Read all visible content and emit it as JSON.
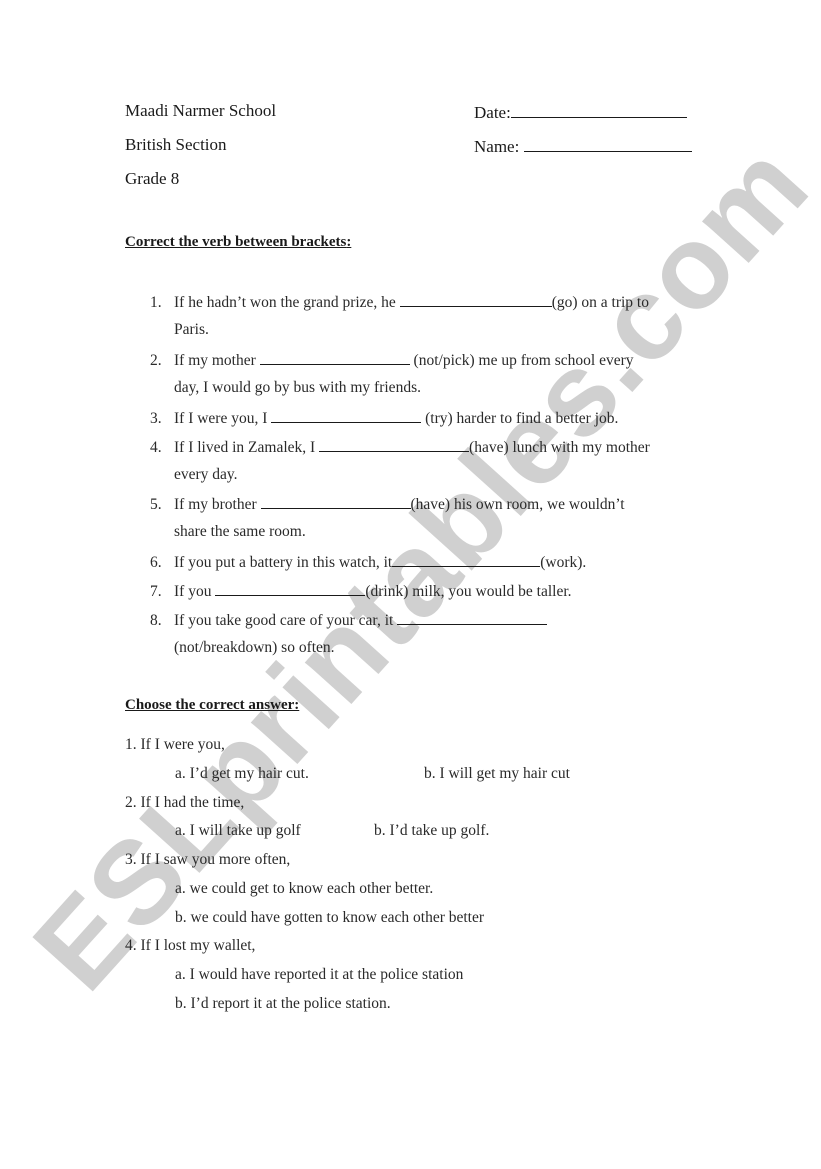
{
  "watermark": "ESLprintables.com",
  "header": {
    "school": "Maadi Narmer School",
    "section": "British Section",
    "grade": "Grade 8",
    "date_label": "Date:",
    "name_label": "Name:"
  },
  "part1": {
    "title": "Correct the verb between brackets",
    "title_colon": ":",
    "items": [
      {
        "num": "1.",
        "before": "If he hadn’t won the grand prize, he ",
        "after": "(go) on a trip to",
        "cont": "Paris."
      },
      {
        "num": "2.",
        "before": "If my mother ",
        "after": " (not/pick) me up from school every",
        "cont": "day, I would go by bus with my friends."
      },
      {
        "num": "3.",
        "before": "If I were you, I ",
        "after": " (try) harder to find a better job.",
        "cont": ""
      },
      {
        "num": "4.",
        "before": "If I lived in Zamalek, I ",
        "after": "(have) lunch with my mother",
        "cont": "every day."
      },
      {
        "num": "5.",
        "before": "If my brother ",
        "after": "(have) his own room, we wouldn’t",
        "cont": "share the same room."
      },
      {
        "num": "6.",
        "before": "If you put a battery in this watch, it",
        "after": "(work).",
        "cont": ""
      },
      {
        "num": "7.",
        "before": "If you ",
        "after": "(drink) milk, you would be taller.",
        "cont": ""
      },
      {
        "num": "8.",
        "before": "If you take good care of your car, it ",
        "after": "",
        "cont": "(not/breakdown) so often."
      }
    ]
  },
  "part2": {
    "title": "Choose the correct answer:",
    "items": [
      {
        "stem": "1. If I were you,",
        "a": "a. I’d get my hair cut.",
        "b": "b. I will get my hair cut"
      },
      {
        "stem": "2. If I had the time,",
        "a": "a. I will take up golf",
        "b": "b. I’d take up golf."
      },
      {
        "stem": "3. If I saw you more often,",
        "a": "a. we could get to know each other better.",
        "b": "b. we could have gotten to know each other better"
      },
      {
        "stem": "4. If I lost my wallet,",
        "a": "a. I would have reported it at the police station",
        "b": "b. I’d report it at the police station."
      }
    ]
  }
}
